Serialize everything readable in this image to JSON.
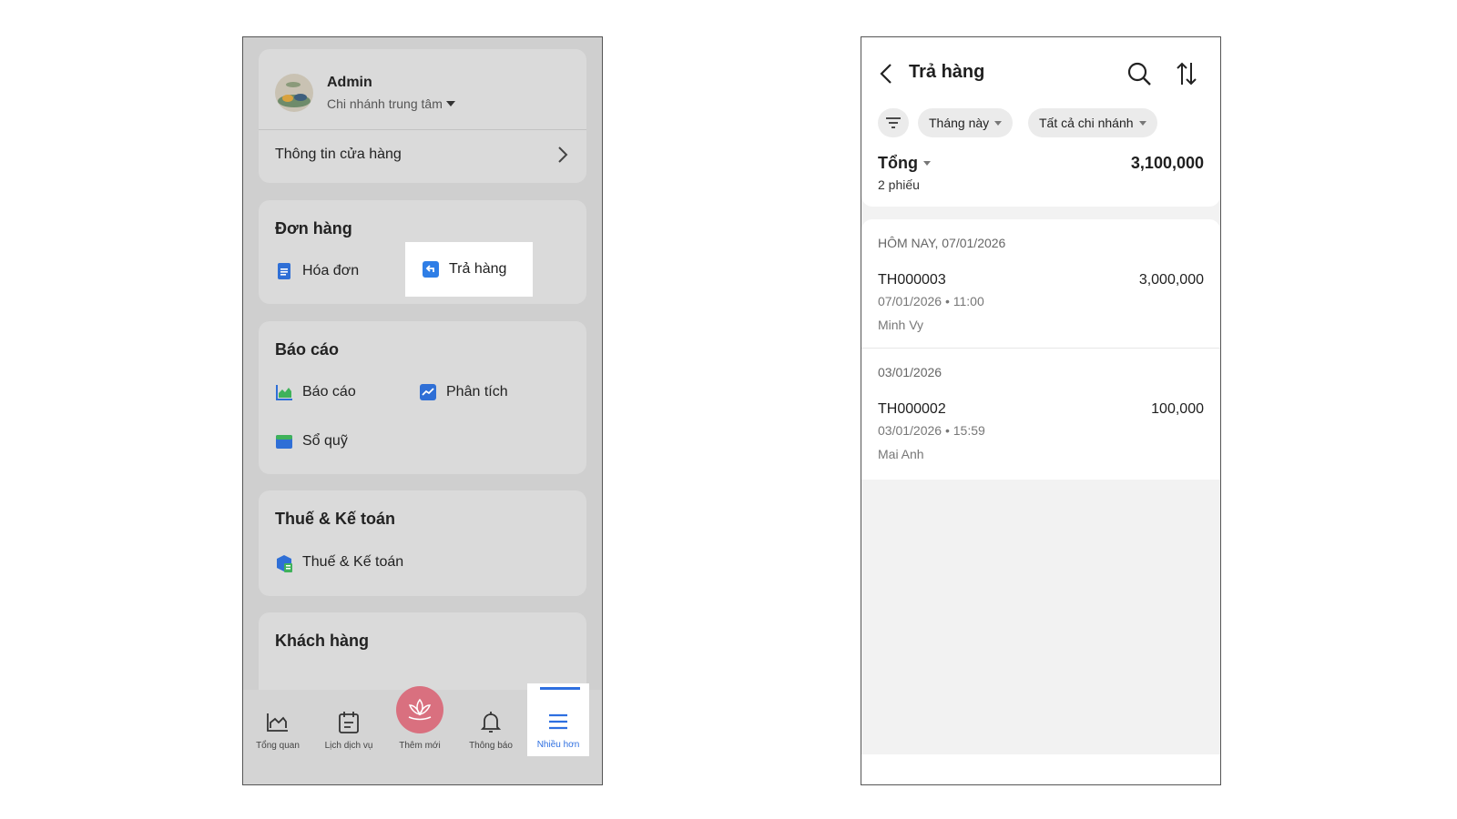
{
  "left": {
    "profile": {
      "name": "Admin",
      "branch": "Chi nhánh trung tâm"
    },
    "store_info": "Thông tin cửa hàng",
    "orders": {
      "title": "Đơn hàng",
      "items": [
        "Hóa đơn",
        "Trả hàng"
      ]
    },
    "reports": {
      "title": "Báo cáo",
      "items": [
        "Báo cáo",
        "Phân tích",
        "Sổ quỹ"
      ]
    },
    "tax": {
      "title": "Thuế & Kế toán",
      "items": [
        "Thuế & Kế toán"
      ]
    },
    "customers": {
      "title": "Khách hàng"
    },
    "bottom_nav": [
      "Tổng quan",
      "Lịch dịch vụ",
      "Thêm mới",
      "Thông báo",
      "Nhiều hơn"
    ]
  },
  "right": {
    "title": "Trả hàng",
    "filters": {
      "period": "Tháng này",
      "branch": "Tất cả chi nhánh"
    },
    "summary": {
      "label": "Tổng",
      "count": "2 phiếu",
      "total": "3,100,000"
    },
    "groups": [
      {
        "date": "HÔM NAY, 07/01/2026",
        "items": [
          {
            "code": "TH000003",
            "amount": "3,000,000",
            "datetime": "07/01/2026 • 11:00",
            "person": "Minh Vy"
          }
        ]
      },
      {
        "date": "03/01/2026",
        "items": [
          {
            "code": "TH000002",
            "amount": "100,000",
            "datetime": "03/01/2026 • 15:59",
            "person": "Mai Anh"
          }
        ]
      }
    ]
  },
  "colors": {
    "accent": "#2e6fe0",
    "brand_center": "#d9707f",
    "highlight": "#ffffff"
  }
}
